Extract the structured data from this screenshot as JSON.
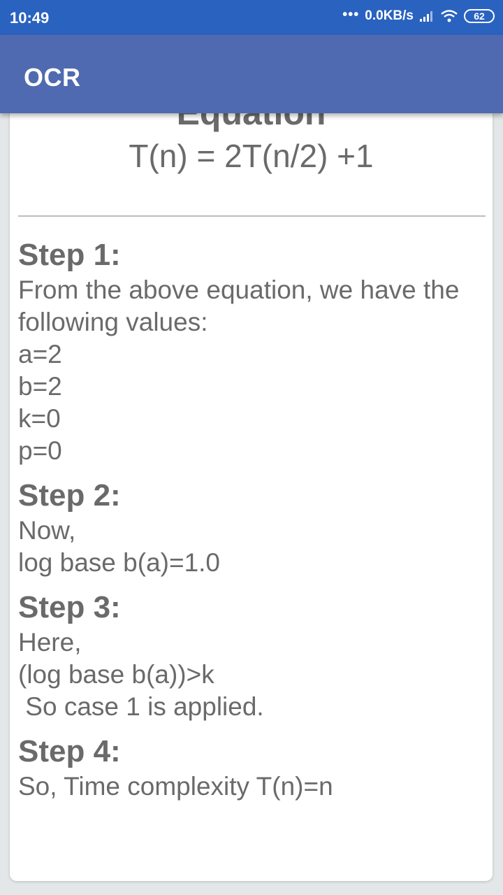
{
  "status_bar": {
    "time": "10:49",
    "dots": "•••",
    "network_speed": "0.0KB/s",
    "battery": "62",
    "icons": [
      "signal-icon",
      "wifi-icon",
      "battery-icon"
    ]
  },
  "app_bar": {
    "title": "OCR"
  },
  "content": {
    "heading": "Equation",
    "equation": "T(n) = 2T(n/2) +1",
    "steps": [
      {
        "title": "Step 1:",
        "lines": [
          "From the above equation, we have the",
          "following values:",
          "a=2",
          "b=2",
          "k=0",
          "p=0"
        ]
      },
      {
        "title": "Step 2:",
        "lines": [
          "Now,",
          "log base b(a)=1.0"
        ]
      },
      {
        "title": "Step 3:",
        "lines": [
          "Here,",
          "(log base b(a))>k",
          " So case 1 is applied."
        ]
      },
      {
        "title": "Step 4:",
        "lines": [
          "So, Time complexity T(n)=n"
        ]
      }
    ]
  },
  "colors": {
    "status_bar": "#2a62c0",
    "app_bar": "#4f6ab0",
    "text": "#6a6a6a",
    "background": "#e3e7e8"
  }
}
